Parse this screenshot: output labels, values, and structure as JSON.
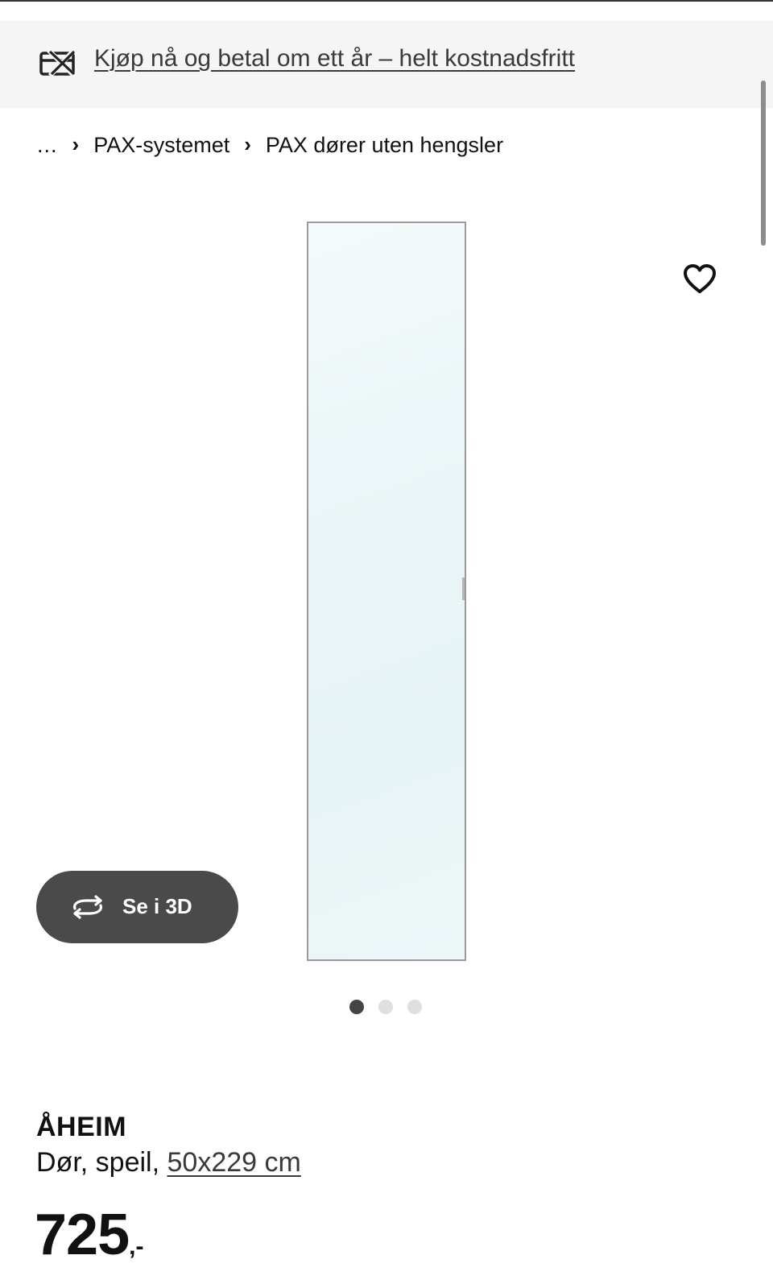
{
  "promo": {
    "icon": "card-crossed-icon",
    "text": "Kjøp nå og betal om ett år – helt kostnadsfritt"
  },
  "breadcrumb": {
    "ellipsis": "...",
    "separator": "›",
    "items": [
      "PAX-systemet",
      "PAX dører uten hengsler"
    ]
  },
  "gallery": {
    "favorite_icon": "heart-outline-icon",
    "view_3d": {
      "icon": "rotate-3d-icon",
      "label": "Se i 3D"
    },
    "image_count": 3,
    "active_image": 1
  },
  "product": {
    "name": "ÅHEIM",
    "description": "Dør, speil,",
    "size": "50x229 cm",
    "price_integer": "725",
    "price_suffix": ",-"
  },
  "colors": {
    "banner_bg": "#f5f5f5",
    "button_bg": "#4a4a4a",
    "dot_active": "#444444",
    "dot_inactive": "#dfdfdf"
  }
}
